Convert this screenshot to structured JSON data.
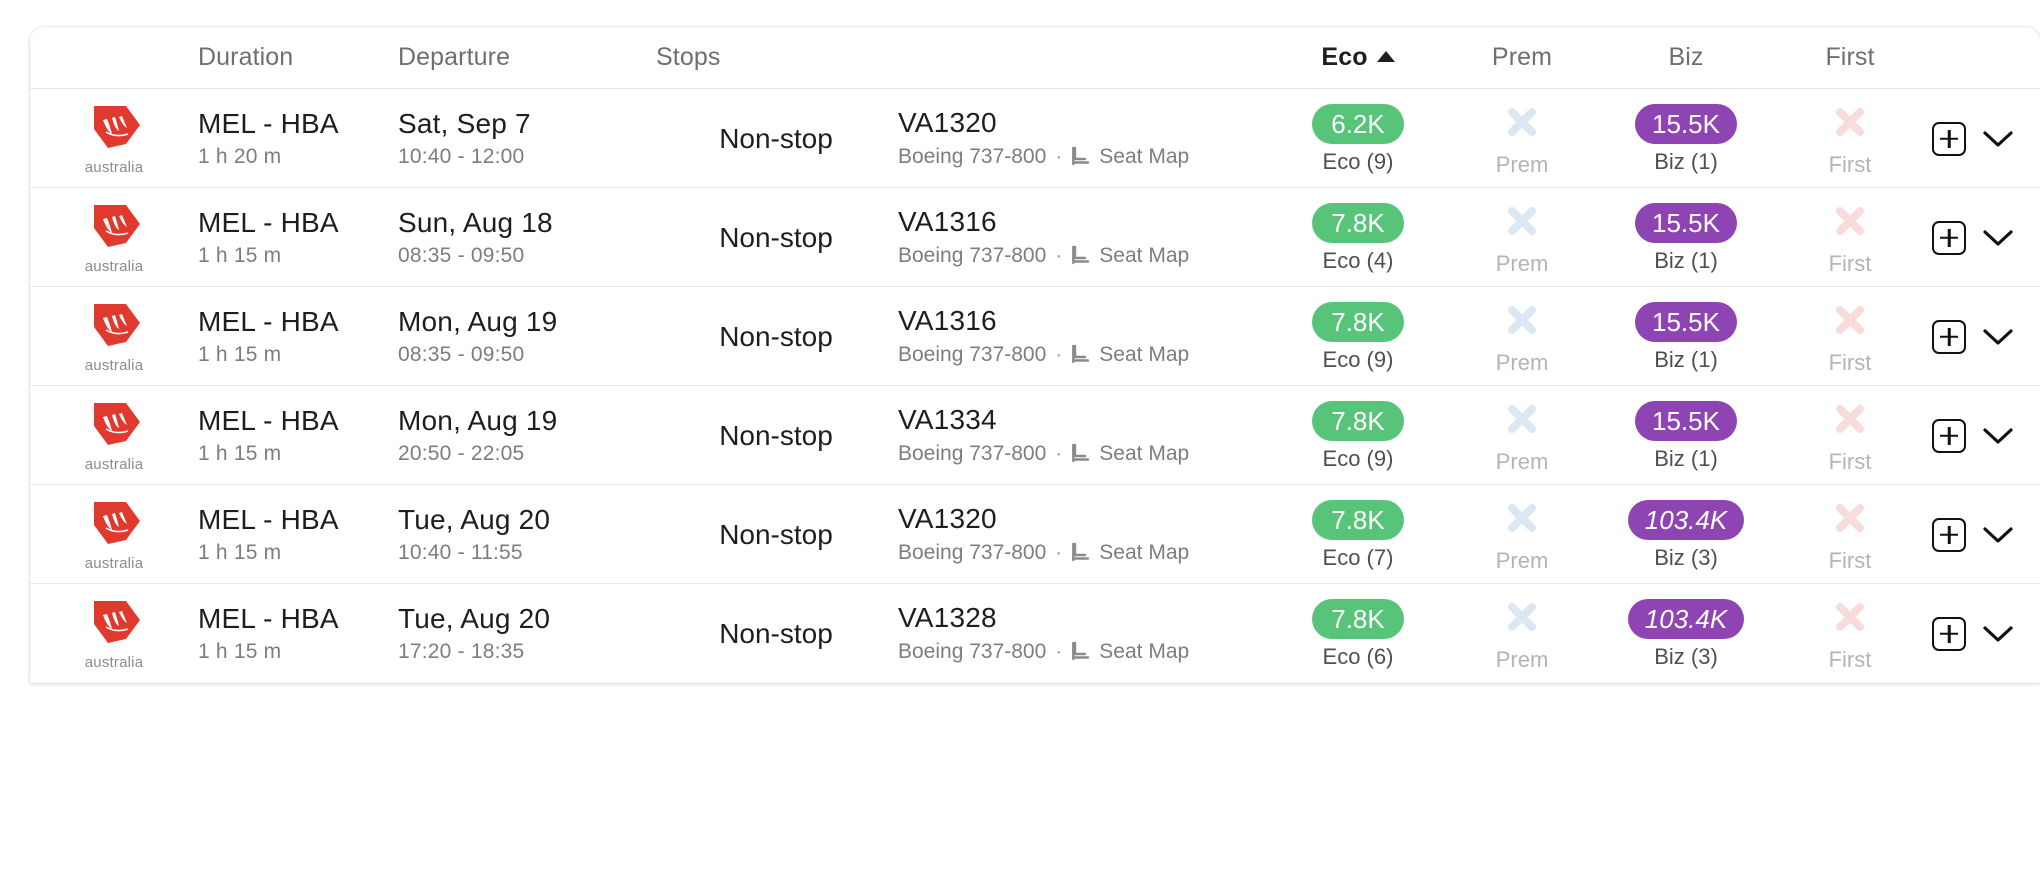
{
  "table": {
    "columns": [
      {
        "key": "airline",
        "label": "",
        "align": "center",
        "active": false
      },
      {
        "key": "duration",
        "label": "Duration",
        "align": "left",
        "active": false
      },
      {
        "key": "departure",
        "label": "Departure",
        "align": "left",
        "active": false
      },
      {
        "key": "stops",
        "label": "Stops",
        "align": "left",
        "active": false
      },
      {
        "key": "flight",
        "label": "",
        "align": "left",
        "active": false
      },
      {
        "key": "eco",
        "label": "Eco",
        "align": "center",
        "active": true
      },
      {
        "key": "prem",
        "label": "Prem",
        "align": "center",
        "active": false
      },
      {
        "key": "biz",
        "label": "Biz",
        "align": "center",
        "active": false
      },
      {
        "key": "first",
        "label": "First",
        "align": "center",
        "active": false
      },
      {
        "key": "actions",
        "label": "",
        "align": "center",
        "active": false
      }
    ],
    "sort": {
      "column": "Eco",
      "direction": "ascending",
      "indicator": "caret-up-icon"
    }
  },
  "colors": {
    "eco_pill": "#57c47a",
    "biz_pill": "#8e44b3",
    "prem_x": "#dbe7f2",
    "first_x": "#f8dcdc",
    "row_border": "#e6e6e6",
    "card_background": "#ffffff"
  },
  "airline": {
    "name": "Virgin Australia",
    "wordmark": "australia",
    "logo_icon": "virgin-australia-logo",
    "logo_color": "#e03a2f"
  },
  "icons": {
    "seat_map": "seat-icon",
    "add": "plus-square-icon",
    "expand": "chevron-down-icon",
    "unavailable": "x-icon"
  },
  "labels": {
    "seat_map": "Seat Map",
    "separator": "·"
  },
  "rows": [
    {
      "route": "MEL - HBA",
      "duration": "1 h 20 m",
      "date": "Sat, Sep 7",
      "times": "10:40 - 12:00",
      "stops": "Non-stop",
      "flight_number": "VA1320",
      "aircraft": "Boeing 737-800",
      "eco": {
        "price": "6.2K",
        "label": "Eco (9)",
        "available": true,
        "italic": false
      },
      "prem": {
        "price": null,
        "label": "Prem",
        "available": false,
        "italic": false
      },
      "biz": {
        "price": "15.5K",
        "label": "Biz (1)",
        "available": true,
        "italic": false
      },
      "first": {
        "price": null,
        "label": "First",
        "available": false,
        "italic": false
      }
    },
    {
      "route": "MEL - HBA",
      "duration": "1 h 15 m",
      "date": "Sun, Aug 18",
      "times": "08:35 - 09:50",
      "stops": "Non-stop",
      "flight_number": "VA1316",
      "aircraft": "Boeing 737-800",
      "eco": {
        "price": "7.8K",
        "label": "Eco (4)",
        "available": true,
        "italic": false
      },
      "prem": {
        "price": null,
        "label": "Prem",
        "available": false,
        "italic": false
      },
      "biz": {
        "price": "15.5K",
        "label": "Biz (1)",
        "available": true,
        "italic": false
      },
      "first": {
        "price": null,
        "label": "First",
        "available": false,
        "italic": false
      }
    },
    {
      "route": "MEL - HBA",
      "duration": "1 h 15 m",
      "date": "Mon, Aug 19",
      "times": "08:35 - 09:50",
      "stops": "Non-stop",
      "flight_number": "VA1316",
      "aircraft": "Boeing 737-800",
      "eco": {
        "price": "7.8K",
        "label": "Eco (9)",
        "available": true,
        "italic": false
      },
      "prem": {
        "price": null,
        "label": "Prem",
        "available": false,
        "italic": false
      },
      "biz": {
        "price": "15.5K",
        "label": "Biz (1)",
        "available": true,
        "italic": false
      },
      "first": {
        "price": null,
        "label": "First",
        "available": false,
        "italic": false
      }
    },
    {
      "route": "MEL - HBA",
      "duration": "1 h 15 m",
      "date": "Mon, Aug 19",
      "times": "20:50 - 22:05",
      "stops": "Non-stop",
      "flight_number": "VA1334",
      "aircraft": "Boeing 737-800",
      "eco": {
        "price": "7.8K",
        "label": "Eco (9)",
        "available": true,
        "italic": false
      },
      "prem": {
        "price": null,
        "label": "Prem",
        "available": false,
        "italic": false
      },
      "biz": {
        "price": "15.5K",
        "label": "Biz (1)",
        "available": true,
        "italic": false
      },
      "first": {
        "price": null,
        "label": "First",
        "available": false,
        "italic": false
      }
    },
    {
      "route": "MEL - HBA",
      "duration": "1 h 15 m",
      "date": "Tue, Aug 20",
      "times": "10:40 - 11:55",
      "stops": "Non-stop",
      "flight_number": "VA1320",
      "aircraft": "Boeing 737-800",
      "eco": {
        "price": "7.8K",
        "label": "Eco (7)",
        "available": true,
        "italic": false
      },
      "prem": {
        "price": null,
        "label": "Prem",
        "available": false,
        "italic": false
      },
      "biz": {
        "price": "103.4K",
        "label": "Biz (3)",
        "available": true,
        "italic": true
      },
      "first": {
        "price": null,
        "label": "First",
        "available": false,
        "italic": false
      }
    },
    {
      "route": "MEL - HBA",
      "duration": "1 h 15 m",
      "date": "Tue, Aug 20",
      "times": "17:20 - 18:35",
      "stops": "Non-stop",
      "flight_number": "VA1328",
      "aircraft": "Boeing 737-800",
      "eco": {
        "price": "7.8K",
        "label": "Eco (6)",
        "available": true,
        "italic": false
      },
      "prem": {
        "price": null,
        "label": "Prem",
        "available": false,
        "italic": false
      },
      "biz": {
        "price": "103.4K",
        "label": "Biz (3)",
        "available": true,
        "italic": true
      },
      "first": {
        "price": null,
        "label": "First",
        "available": false,
        "italic": false
      }
    }
  ]
}
